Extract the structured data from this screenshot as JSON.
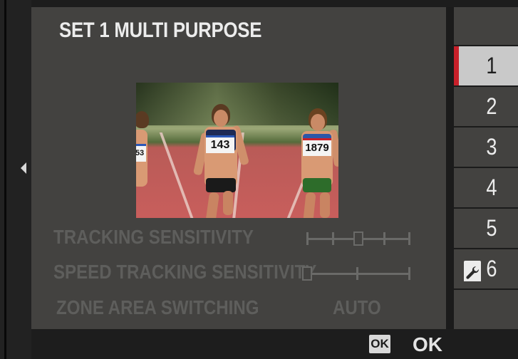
{
  "screen": {
    "title": "SET 1 MULTI PURPOSE"
  },
  "preview": {
    "bibs": [
      "143",
      "1879",
      "53"
    ]
  },
  "settings": [
    {
      "label": "TRACKING SENSITIVITY",
      "control": "slider",
      "level": 2,
      "levels": 5
    },
    {
      "label": "SPEED TRACKING SENSITIVITY",
      "control": "slider",
      "level": 0,
      "levels": 3
    },
    {
      "label": "ZONE AREA SWITCHING",
      "control": "value",
      "value": "AUTO"
    }
  ],
  "tabs": [
    {
      "label": "1",
      "active": true
    },
    {
      "label": "2",
      "active": false
    },
    {
      "label": "3",
      "active": false
    },
    {
      "label": "4",
      "active": false
    },
    {
      "label": "5",
      "active": false
    },
    {
      "label": "6",
      "active": false,
      "icon": "wrench-icon"
    }
  ],
  "footer": {
    "ok_icon": "OK",
    "ok_label": "OK"
  },
  "colors": {
    "accent": "#c8202a",
    "panel": "#434240",
    "active_tab": "#c9c9c9",
    "disabled_text": "#5e5e5c"
  }
}
